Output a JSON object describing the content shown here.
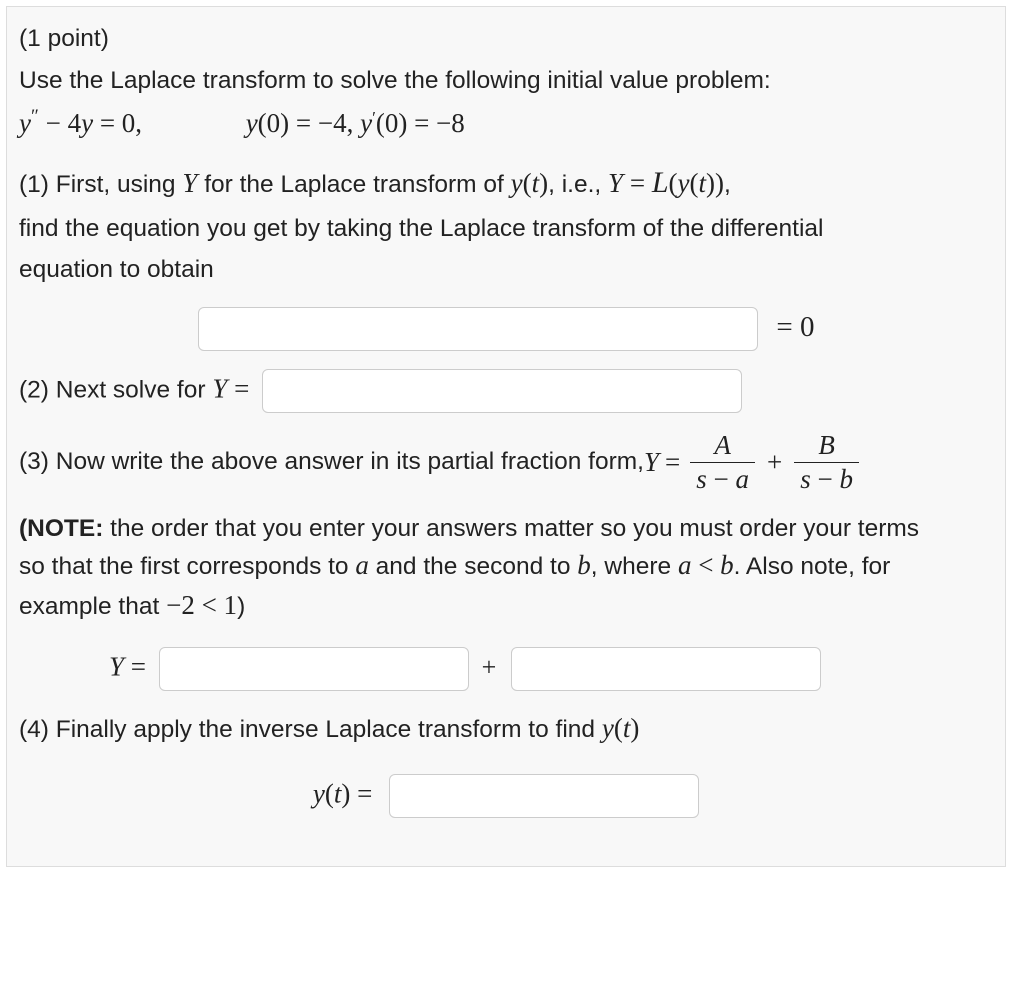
{
  "header": {
    "points": "(1 point)",
    "intro": "Use the Laplace transform to solve the following initial value problem:"
  },
  "ode": {
    "eq_lhs": "y″ − 4y = 0,",
    "ic1": "y(0) = −4,",
    "ic2": "y′(0) = −8"
  },
  "part1": {
    "label": "(1) First, using ",
    "text_a": " for the Laplace transform of ",
    "text_b": ", i.e., ",
    "text_c": ",",
    "line2": "find the equation you get by taking the Laplace transform of the differential",
    "line3": "equation to obtain",
    "rhs": "= 0"
  },
  "part2": {
    "label": "(2) Next solve for ",
    "eq_sym": "Y ="
  },
  "part3": {
    "label": "(3) Now write the above answer in its partial fraction form, ",
    "eq": "Y =",
    "frac1_num": "A",
    "frac1_den": "s − a",
    "plus": "+",
    "frac2_num": "B",
    "frac2_den": "s − b"
  },
  "note": {
    "bold": "(NOTE:",
    "text1": " the order that you enter your answers matter so you must order your terms",
    "text2": "so that the first corresponds to ",
    "text3": " and the second to ",
    "text4": ", where ",
    "text5": ". Also note, for",
    "text6": "example that ",
    "text7": ")",
    "a": "a",
    "b": "b",
    "cond": "a < b",
    "ex": "−2 < 1"
  },
  "part3b": {
    "lhs": "Y =",
    "plus": "+"
  },
  "part4": {
    "label": "(4) Finally apply the inverse Laplace transform to find ",
    "yt": "y(t)",
    "lhs": "y(t) ="
  }
}
